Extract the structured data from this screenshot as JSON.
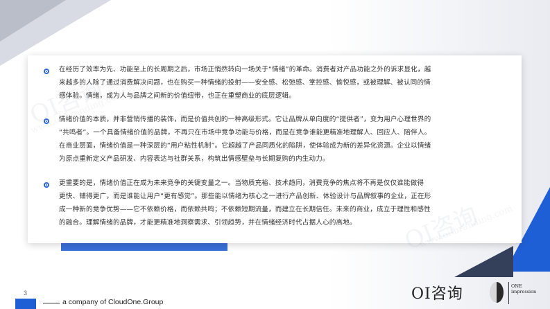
{
  "slide": {
    "page_number": "3",
    "footer_text": "a company of CloudOne.Group",
    "watermark_text": "OI咨询",
    "watermark_url": "www.oi-branding.com"
  },
  "logo": {
    "main": "OI咨询",
    "sub_line1": "ONE",
    "sub_line2": "impression"
  },
  "paragraphs": [
    {
      "lines": [
        "在经历了效率为先、功能至上的长周期之后，市场正悄然转向一场关于“情绪”的革命。消费者对产品功能之外的诉求显化，越",
        "来越多的人除了通过消费解决问题，也在购买一种情绪的投射——安全感、松弛感、掌控感、愉悦感，或被理解、被认同的情",
        "感体验。情绪，成为人与品牌之间新的价值纽带，也正在重塑商业的底层逻辑。"
      ]
    },
    {
      "lines": [
        "情绪价值的本质，并非营销传播的装饰，而是价值共创的一种高级形式。它让品牌从单向度的“提供者”，变为用户心理世界的",
        "“共鸣者”。一个具备情绪价值的品牌，不再只在市场中竞争功能与价格，而是在竞争谁能更精准地理解人、回应人、陪伴人。",
        "在商业层面，情绪价值是一种深层的“用户粘性机制”。它超越了产品同质化的陷阱，使体验成为新的差异化资源。企业以情绪",
        "为原点重新定义产品研发、内容表达与社群关系，构筑出情感壁垒与长期复购的内生动力。"
      ]
    },
    {
      "lines": [
        "更重要的是，情绪价值正在成为未来竞争的关键变量之一。当物质充裕、技术趋同，消费竞争的焦点将不再是仅仅谁能做得",
        "更快、铺得更广，而是谁能让用户“更有感觉”。那些能以情绪为核心之一进行产品创新、体验设计与品牌叙事的企业，正在形",
        "成一种新的竞争优势——它不依赖价格，而依赖共鸣；不依赖短期流量，而建立在长期信任。未来的商业，成立于理性和感性",
        "的融合。理解情绪的品牌，才能更精准地洞察需求、引领趋势，并在情绪经济时代占据人心的高地。"
      ]
    }
  ],
  "colors": {
    "accent_blue": "#1f5fd6",
    "dark_navy": "#34405a",
    "text": "#333333"
  }
}
